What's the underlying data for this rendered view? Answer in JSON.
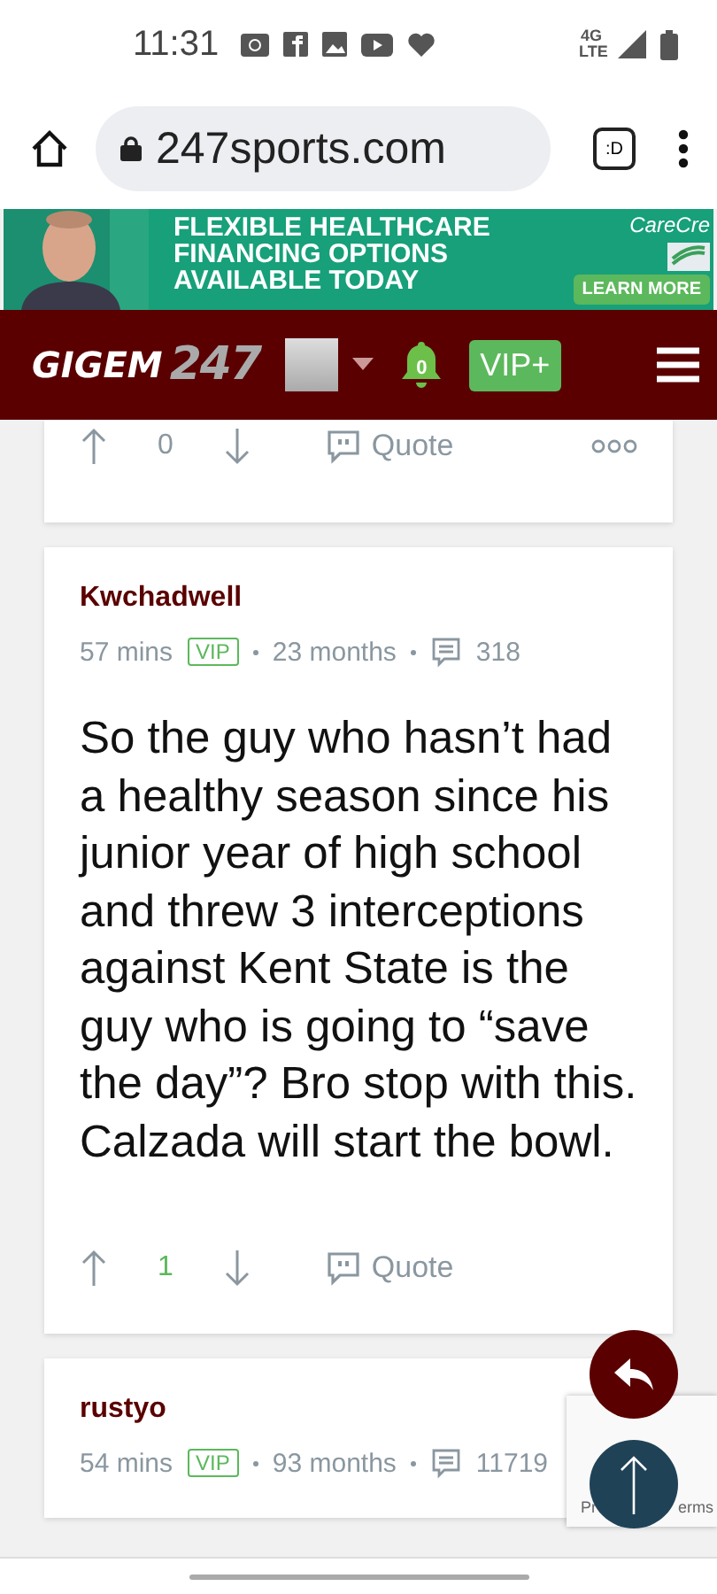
{
  "status_bar": {
    "time": "11:31",
    "network": "4G LTE"
  },
  "browser": {
    "url_shown": "247sports.com",
    "tab_label": ":D"
  },
  "ad": {
    "headline": "FLEXIBLE HEALTHCARE FINANCING OPTIONS AVAILABLE TODAY",
    "brand": "CareCre",
    "button": "LEARN MORE"
  },
  "header": {
    "logo_word": "GIGEM",
    "logo_number": "247",
    "notifications": "0",
    "vip_button": "VIP+"
  },
  "posts": [
    {
      "partial": true,
      "votes": "0",
      "voted": false,
      "quote": "Quote"
    },
    {
      "partial": false,
      "author": "Kwchadwell",
      "time": "57 mins",
      "badge": "VIP",
      "tenure": "23 months",
      "post_count": "318",
      "body": "So the guy who hasn’t had a healthy season since his junior year of high school and threw 3 interceptions against Kent State is the guy who is going to “save the day”? Bro stop with this. Calzada will start the bowl.",
      "votes": "1",
      "voted": true,
      "quote": "Quote"
    },
    {
      "partial": false,
      "author": "rustyo",
      "time": "54 mins",
      "badge": "VIP",
      "tenure": "93 months",
      "post_count": "11719"
    }
  ],
  "recaptcha": {
    "left_text": "Pr",
    "right_text": "erms"
  }
}
